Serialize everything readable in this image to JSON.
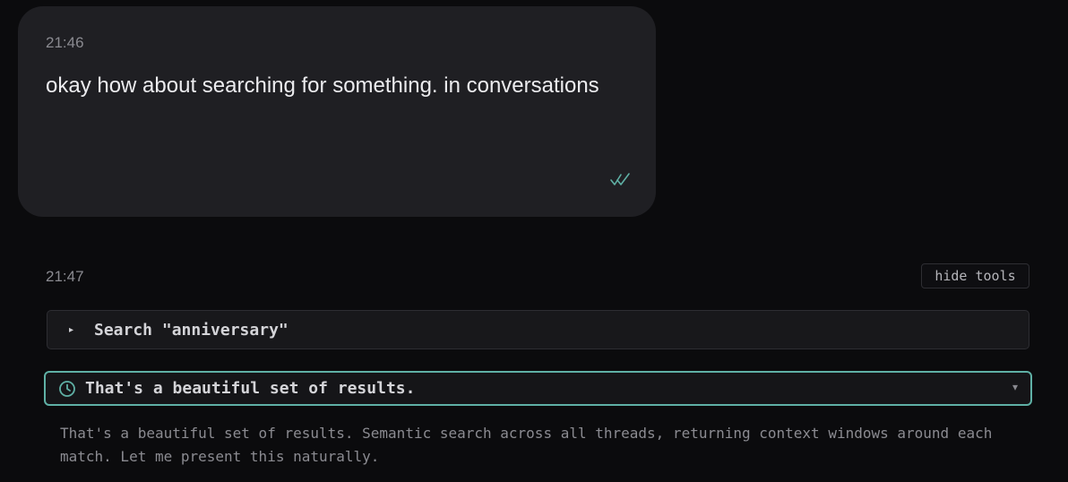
{
  "user_message": {
    "time": "21:46",
    "text": "okay how about searching for something. in conversations",
    "status_icon": "double-check-icon"
  },
  "assistant_message": {
    "time": "21:47",
    "hide_tools_label": "hide tools",
    "tool_call": {
      "caret": "▸",
      "label": "Search \"anniversary\""
    },
    "thinking": {
      "icon": "clock-icon",
      "title": "That's a beautiful set of results.",
      "caret": "▾",
      "body": "That's a beautiful set of results. Semantic search across all threads, returning context windows around each match. Let me present this naturally."
    }
  },
  "colors": {
    "background": "#0b0b0d",
    "user_bubble": "#1f1f23",
    "accent": "#5fb0a5",
    "muted_text": "#8a8a90"
  }
}
